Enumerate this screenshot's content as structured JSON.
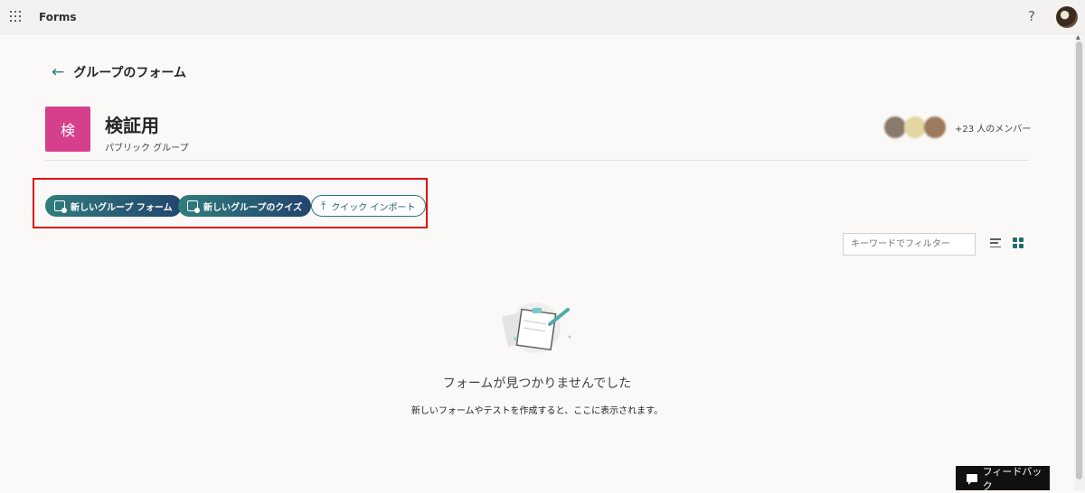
{
  "app": {
    "name": "Forms"
  },
  "header": {
    "help_label": "?"
  },
  "nav": {
    "back_title": "グループのフォーム"
  },
  "group": {
    "initial": "検",
    "name": "検証用",
    "type": "パブリック グループ",
    "members_text": "+23 人のメンバー"
  },
  "actions": {
    "new_form": "新しいグループ フォーム",
    "new_quiz": "新しいグループのクイズ",
    "quick_import": "クイック インポート"
  },
  "filter": {
    "placeholder": "キーワードでフィルター"
  },
  "empty": {
    "title": "フォームが見つかりませんでした",
    "description": "新しいフォームやテストを作成すると、ここに表示されます。"
  },
  "feedback": {
    "label": "フィードバック"
  },
  "colors": {
    "accent": "#2b7a7a",
    "group_tile": "#d63f8c",
    "highlight": "#e01010"
  }
}
